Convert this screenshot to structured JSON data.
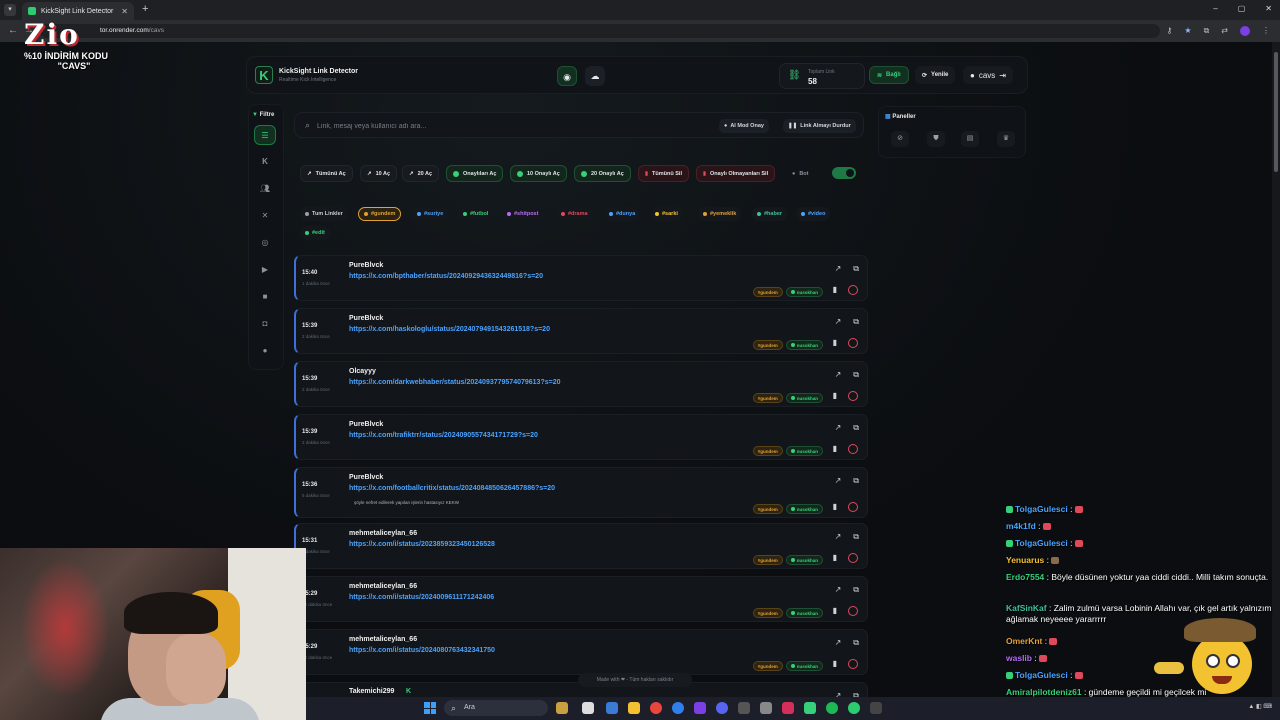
{
  "browser": {
    "tab_title": "KickSight Link Detector",
    "url_host": "tor.onrender.com",
    "url_path": "/cavs",
    "win_min": "–",
    "win_max": "▢",
    "win_close": "✕"
  },
  "promo": {
    "brand": "Zio",
    "line1": "%10 İNDİRİM KODU",
    "line2": "\"CAVS\""
  },
  "header": {
    "app_name": "KickSight Link Detector",
    "app_subtitle": "Realtime Kick Intelligence",
    "stat_label": "Toplam Link",
    "stat_value": "58",
    "connected_label": "Bağlı",
    "refresh_label": "Yenile",
    "user_label": "cavs"
  },
  "sidebar": {
    "filter_label": "Filtre",
    "items": [
      "list-icon",
      "kick-icon",
      "users-icon",
      "x-icon",
      "instagram-icon",
      "youtube-icon",
      "video-icon",
      "camera-icon",
      "globe-icon"
    ]
  },
  "search": {
    "placeholder": "Link, mesaj veya kullanıcı adı ara...",
    "ai_mode": "AI Mod Onay",
    "stop_links": "Link Almayı Durdur"
  },
  "actions": {
    "open_all": "Tümünü Aç",
    "open_10": "10 Aç",
    "open_20": "20 Aç",
    "open_approved": "Onaylıları Aç",
    "open_10_approved": "10 Onaylı Aç",
    "open_20_approved": "20 Onaylı Aç",
    "delete_all": "Tümünü Sil",
    "delete_unapproved": "Onaylı Olmayanları Sil",
    "bot": "Bot"
  },
  "tags": [
    {
      "label": "Tum Linkler",
      "color": "#9aa1aa"
    },
    {
      "label": "#gundem",
      "color": "#e2a135"
    },
    {
      "label": "#suriye",
      "color": "#4aa3ff"
    },
    {
      "label": "#futbol",
      "color": "#36d07a"
    },
    {
      "label": "#shitpost",
      "color": "#b36cf5"
    },
    {
      "label": "#drama",
      "color": "#e0485b"
    },
    {
      "label": "#dunya",
      "color": "#4aa3ff"
    },
    {
      "label": "#sarki",
      "color": "#f2c230"
    },
    {
      "label": "#yemeklik",
      "color": "#e2a135"
    },
    {
      "label": "#haber",
      "color": "#3fbfa0"
    },
    {
      "label": "#video",
      "color": "#4aa3ff"
    },
    {
      "label": "#edit",
      "color": "#36d07a"
    }
  ],
  "links": [
    {
      "time": "15:40",
      "ago": "1 dakika önce",
      "user": "PureBlvck",
      "url": "https://x.com/bpthaber/status/2024092943632449816?s=20",
      "msg": "",
      "tag": "#gundem",
      "approver": "nusokhan"
    },
    {
      "time": "15:39",
      "ago": "2 dakika önce",
      "user": "PureBlvck",
      "url": "https://x.com/haskologlu/status/2024079491543261518?s=20",
      "msg": "",
      "tag": "#gundem",
      "approver": "nusokhan"
    },
    {
      "time": "15:39",
      "ago": "2 dakika önce",
      "user": "Olcayyy",
      "url": "https://x.com/darkwebhaber/status/2024093779574079613?s=20",
      "msg": "",
      "tag": "#gundem",
      "approver": "nusokhan"
    },
    {
      "time": "15:39",
      "ago": "2 dakika önce",
      "user": "PureBlvck",
      "url": "https://x.com/trafiktrr/status/2024090557434171729?s=20",
      "msg": "",
      "tag": "#gundem",
      "approver": "nusokhan"
    },
    {
      "time": "15:36",
      "ago": "5 dakika önce",
      "user": "PureBlvck",
      "url": "https://x.com/footballcritix/status/2024084850626457886?s=20",
      "msg": "şöyle nefret edilerek yapılan işlerin hastasıyız KEKW",
      "tag": "#gundem",
      "approver": "nusokhan"
    },
    {
      "time": "15:31",
      "ago": "9 dakika önce",
      "user": "mehmetaliceylan_66",
      "url": "https://x.com/i/status/2023859323450126528",
      "msg": "",
      "tag": "#gundem",
      "approver": "nusokhan"
    },
    {
      "time": "15:29",
      "ago": "12 dakika önce",
      "user": "mehmetaliceylan_66",
      "url": "https://x.com/i/status/2024009611171242406",
      "msg": "",
      "tag": "#gundem",
      "approver": "nusokhan"
    },
    {
      "time": "15:29",
      "ago": "12 dakika önce",
      "user": "mehmetaliceylan_66",
      "url": "https://x.com/i/status/2024080763432341750",
      "msg": "",
      "tag": "#gundem",
      "approver": "nusokhan"
    },
    {
      "time": "",
      "ago": "",
      "user": "Takemichi299",
      "url": "",
      "msg": "",
      "tag": "",
      "approver": ""
    }
  ],
  "panels": {
    "title": "Paneller"
  },
  "footer": {
    "made_with": "Made with ❤ - Tüm hakları saklıdır"
  },
  "chat": [
    {
      "user": "TolgaGulesci",
      "color": "#4aa3ff",
      "text": "",
      "kick": true,
      "emote": "#e0485b"
    },
    {
      "user": "m4k1fd",
      "color": "#4aa3ff",
      "text": "",
      "kick": false,
      "emote": "#e0485b"
    },
    {
      "user": "TolgaGulesci",
      "color": "#4aa3ff",
      "text": "",
      "kick": true,
      "emote": "#e0485b"
    },
    {
      "user": "Yenuarus",
      "color": "#f2c230",
      "text": "",
      "kick": false,
      "emote": "#8a6a4a"
    },
    {
      "user": "Erdo7554",
      "color": "#36d07a",
      "text": "Böyle düsünen yoktur yaa ciddi ciddi.. Milli takım sonuçta.",
      "kick": false,
      "emote": ""
    },
    {
      "user": "KafSinKaf",
      "color": "#3fbfa0",
      "text": "Zalim zulmü varsa Lobinin Allahı var, çık gel artık yalnızım ağlamak neyeeee yararrrrr",
      "kick": false,
      "emote": ""
    },
    {
      "user": "OmerKnt",
      "color": "#e2a135",
      "text": "",
      "kick": false,
      "emote": "#e0485b"
    },
    {
      "user": "waslib",
      "color": "#b36cf5",
      "text": "",
      "kick": false,
      "emote": "#e0485b"
    },
    {
      "user": "TolgaGulesci",
      "color": "#4aa3ff",
      "text": "",
      "kick": true,
      "emote": "#e0485b"
    },
    {
      "user": "Amiralpilotdeniz61",
      "color": "#36d07a",
      "text": "gündeme geçildi mi geçilcek mi",
      "kick": false,
      "emote": ""
    }
  ],
  "taskbar": {
    "search_label": "Ara"
  },
  "colors": {
    "accent": "#36d07a",
    "link": "#4aa3ff",
    "tag_gundem": "#e2a135",
    "danger": "#e0485b"
  }
}
